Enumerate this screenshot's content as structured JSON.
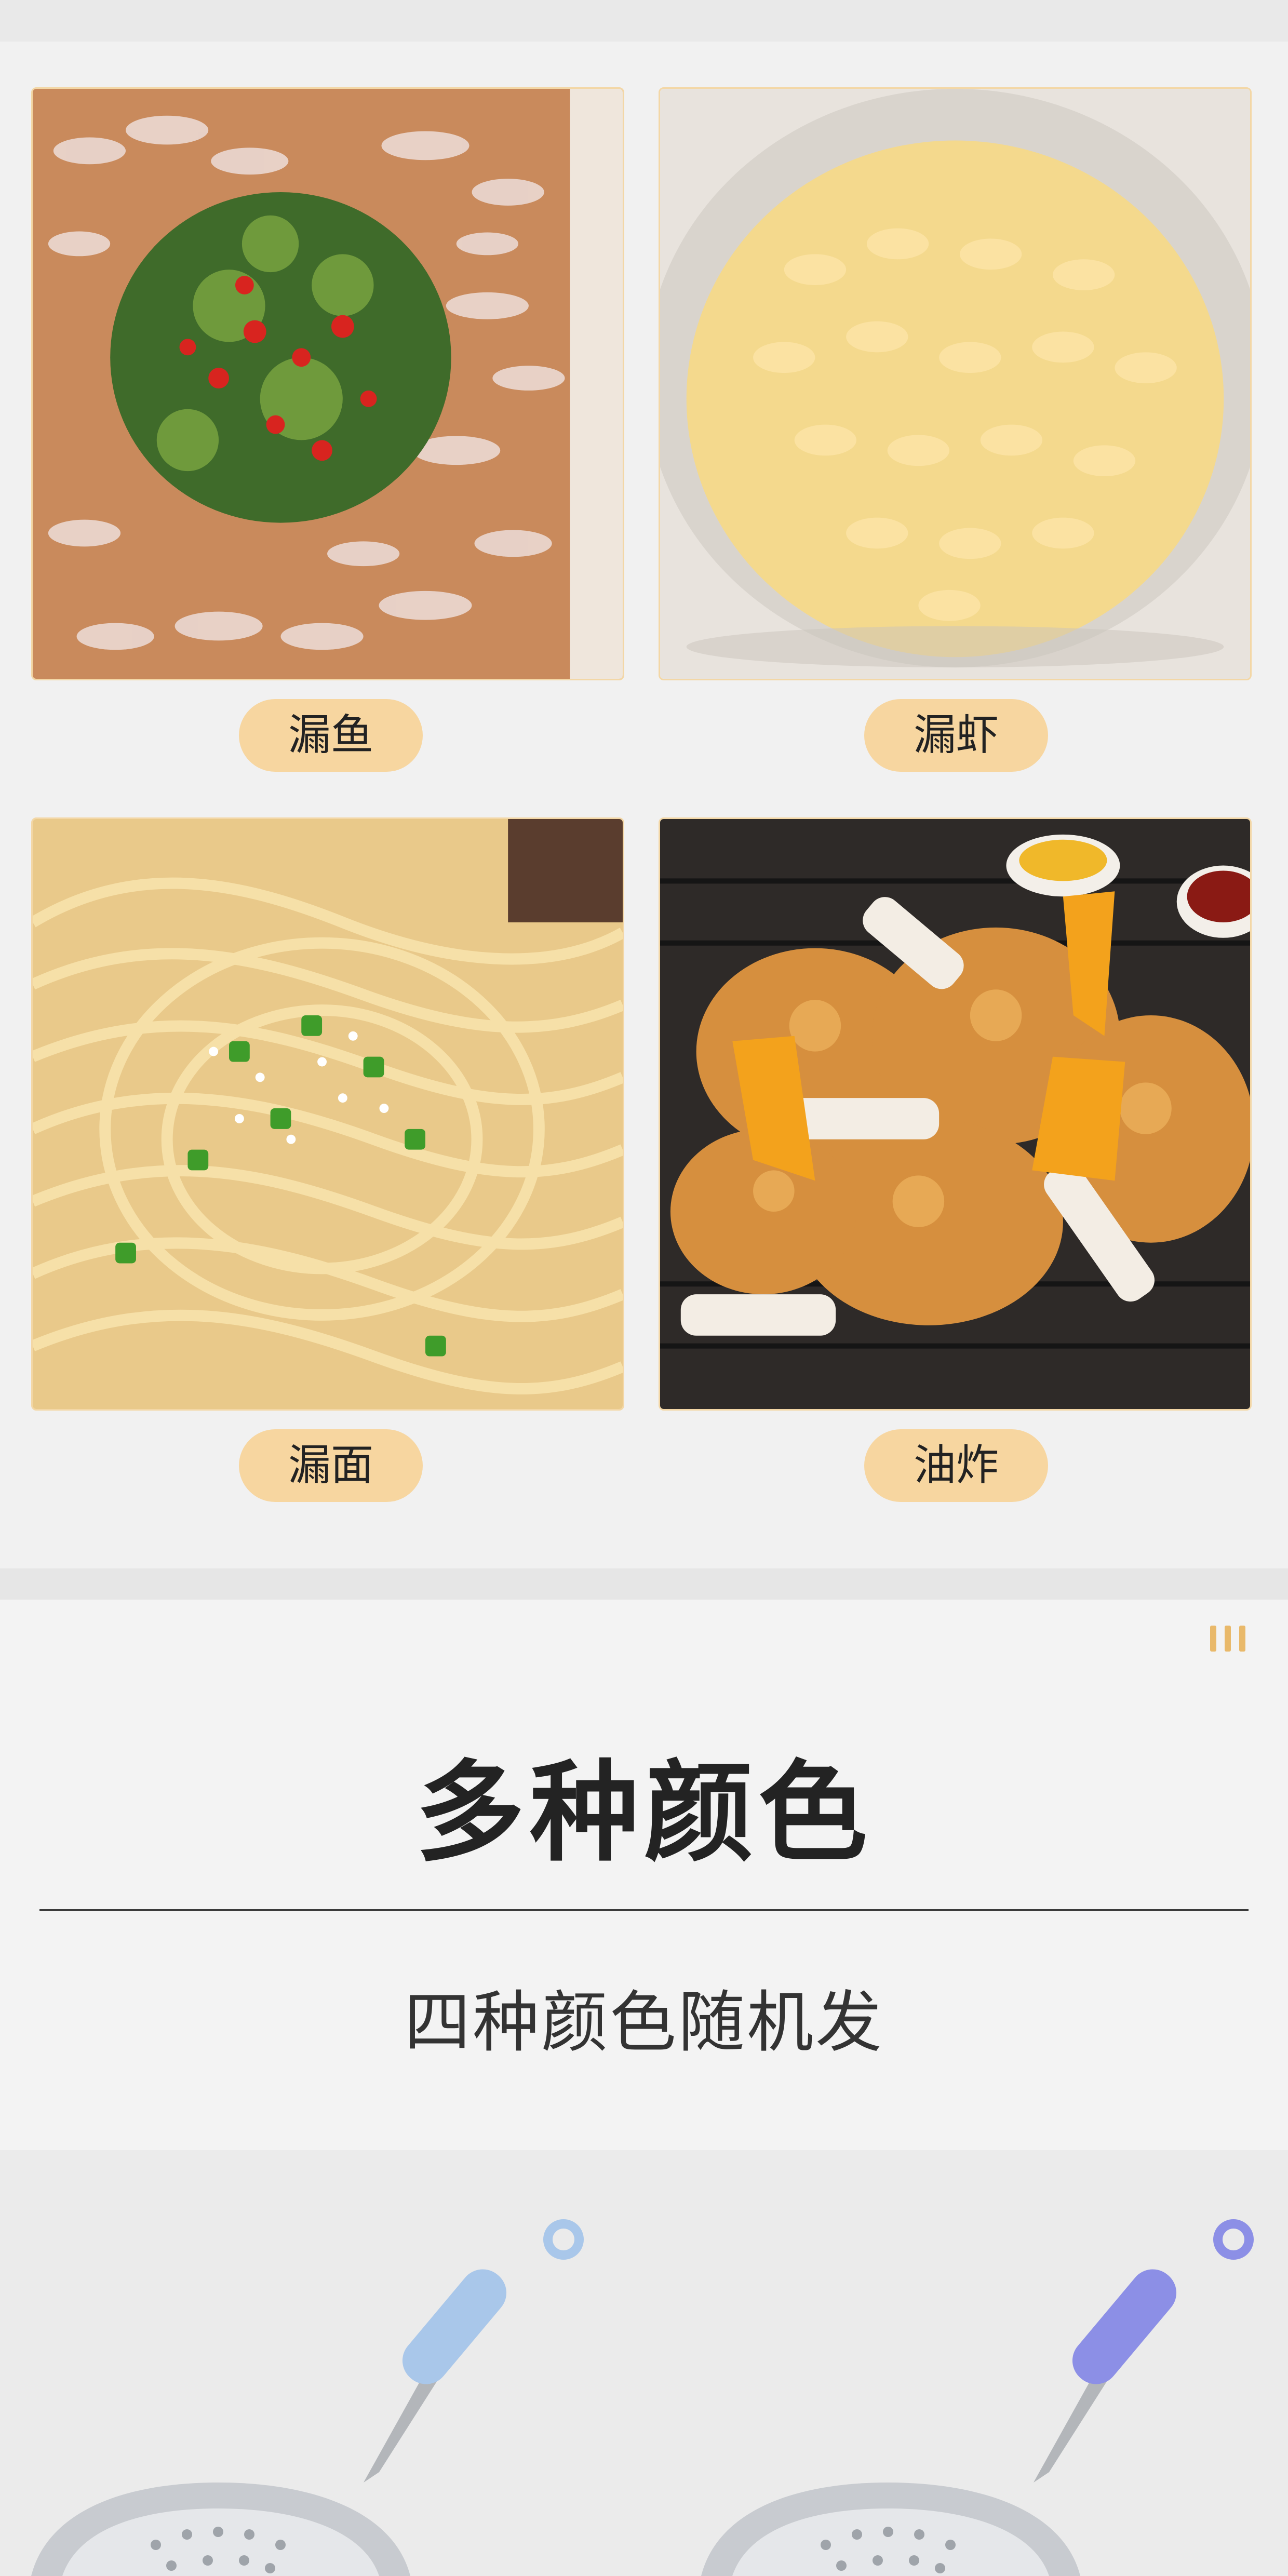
{
  "usage_items": [
    {
      "label": "漏鱼",
      "icon": "jelly-fish-noodle-photo"
    },
    {
      "label": "漏虾",
      "icon": "jelly-shrimp-photo"
    },
    {
      "label": "漏面",
      "icon": "noodles-photo"
    },
    {
      "label": "油炸",
      "icon": "fried-chicken-photo"
    }
  ],
  "colors_section": {
    "title": "多种颜色",
    "subtitle": "四种颜色随机发"
  },
  "handle_colors": [
    "#a9c7ea",
    "#8c8fe6"
  ],
  "accent": "#f7d6a0"
}
